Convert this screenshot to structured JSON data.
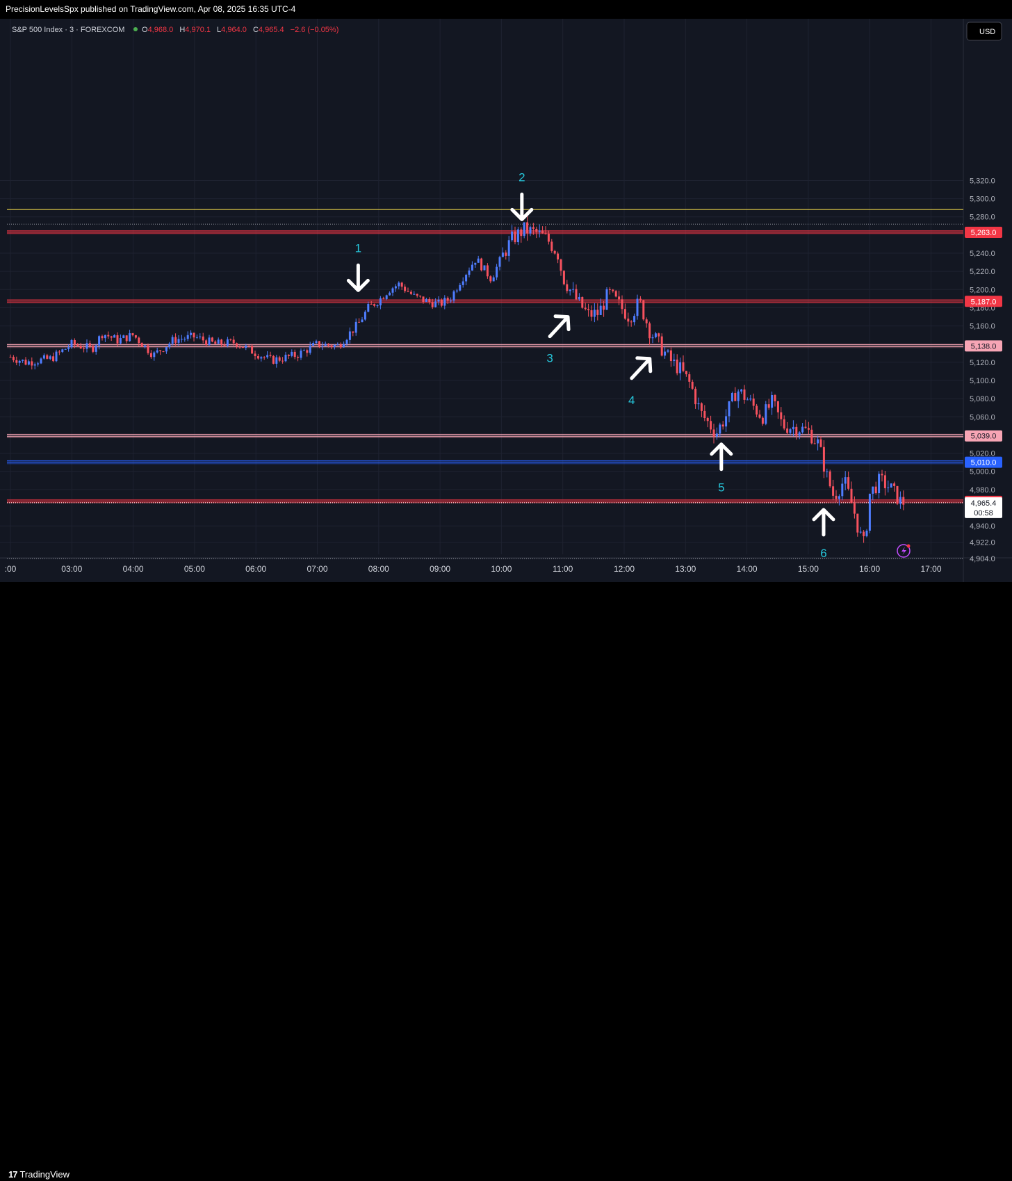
{
  "header": {
    "published": "PrecisionLevelsSpx published on TradingView.com, Apr 08, 2025 16:35 UTC-4"
  },
  "legend": {
    "symbol": "S&P 500 Index · 3 · FOREXCOM",
    "o_label": "O",
    "o_value": "4,968.0",
    "h_label": "H",
    "h_value": "4,970.1",
    "l_label": "L",
    "l_value": "4,964.0",
    "c_label": "C",
    "c_value": "4,965.4",
    "change": "−2.6 (−0.05%)"
  },
  "currency_button": "USD",
  "footer": {
    "brand": "TradingView",
    "logo_mark": "17"
  },
  "colors": {
    "background": "#131722",
    "panel": "#000000",
    "up": "#2962ff",
    "down": "#f23645",
    "pink_level": "#f7a5b5",
    "blue_level": "#2962ff",
    "yellow_level": "#e5cf48",
    "annotation": "#26c6da",
    "arrow": "#ffffff",
    "text": "#d1d4dc"
  },
  "chart_data": {
    "type": "candlestick",
    "x_axis_labels": [
      ":00",
      "03:00",
      "04:00",
      "05:00",
      "06:00",
      "07:00",
      "08:00",
      "09:00",
      "10:00",
      "11:00",
      "12:00",
      "13:00",
      "14:00",
      "15:00",
      "16:00",
      "17:00"
    ],
    "y_axis_labels": [
      "5,320.0",
      "5,300.0",
      "5,280.0",
      "5,240.0",
      "5,220.0",
      "5,200.0",
      "5,180.0",
      "5,160.0",
      "5,120.0",
      "5,100.0",
      "5,080.0",
      "5,060.0",
      "5,020.0",
      "5,000.0",
      "4,980.0",
      "4,940.0",
      "4,922.0",
      "4,904.0"
    ],
    "y_range": [
      4904,
      5320
    ],
    "levels": [
      {
        "value": 5263.0,
        "label": "5,263.0",
        "color": "red"
      },
      {
        "value": 5187.0,
        "label": "5,187.0",
        "color": "red"
      },
      {
        "value": 5138.0,
        "label": "5,138.0",
        "color": "pink"
      },
      {
        "value": 5039.0,
        "label": "5,039.0",
        "color": "pink"
      },
      {
        "value": 5010.0,
        "label": "5,010.0",
        "color": "blue"
      },
      {
        "value": 4967.0,
        "label": "4,967.0",
        "color": "red"
      }
    ],
    "yellow_line": 5288,
    "current_price": {
      "value": 4965.4,
      "label": "4,965.4",
      "countdown": "00:58"
    },
    "dotted_lines": [
      5272,
      4904
    ],
    "path_points": [
      [
        "02:00",
        5126
      ],
      [
        "02:15",
        5120
      ],
      [
        "02:40",
        5124
      ],
      [
        "03:00",
        5140
      ],
      [
        "03:20",
        5135
      ],
      [
        "03:30",
        5152
      ],
      [
        "03:45",
        5144
      ],
      [
        "04:00",
        5150
      ],
      [
        "04:20",
        5128
      ],
      [
        "04:40",
        5145
      ],
      [
        "05:00",
        5148
      ],
      [
        "05:20",
        5140
      ],
      [
        "05:40",
        5142
      ],
      [
        "06:00",
        5130
      ],
      [
        "06:15",
        5122
      ],
      [
        "06:40",
        5128
      ],
      [
        "07:00",
        5140
      ],
      [
        "07:20",
        5138
      ],
      [
        "07:40",
        5162
      ],
      [
        "07:50",
        5180
      ],
      [
        "08:00",
        5188
      ],
      [
        "08:10",
        5200
      ],
      [
        "08:20",
        5206
      ],
      [
        "08:35",
        5192
      ],
      [
        "08:50",
        5186
      ],
      [
        "09:00",
        5184
      ],
      [
        "09:10",
        5190
      ],
      [
        "09:20",
        5210
      ],
      [
        "09:35",
        5234
      ],
      [
        "09:50",
        5212
      ],
      [
        "10:00",
        5235
      ],
      [
        "10:10",
        5255
      ],
      [
        "10:22",
        5266
      ],
      [
        "10:35",
        5262
      ],
      [
        "10:45",
        5255
      ],
      [
        "10:55",
        5240
      ],
      [
        "11:00",
        5214
      ],
      [
        "11:08",
        5198
      ],
      [
        "11:15",
        5186
      ],
      [
        "11:25",
        5172
      ],
      [
        "11:35",
        5174
      ],
      [
        "11:45",
        5196
      ],
      [
        "11:55",
        5183
      ],
      [
        "12:05",
        5170
      ],
      [
        "12:15",
        5186
      ],
      [
        "12:25",
        5155
      ],
      [
        "12:35",
        5138
      ],
      [
        "12:45",
        5122
      ],
      [
        "12:55",
        5112
      ],
      [
        "13:05",
        5095
      ],
      [
        "13:15",
        5064
      ],
      [
        "13:30",
        5042
      ],
      [
        "13:40",
        5062
      ],
      [
        "13:50",
        5090
      ],
      [
        "14:00",
        5080
      ],
      [
        "14:15",
        5060
      ],
      [
        "14:25",
        5076
      ],
      [
        "14:35",
        5050
      ],
      [
        "14:50",
        5048
      ],
      [
        "15:00",
        5044
      ],
      [
        "15:10",
        5030
      ],
      [
        "15:18",
        4995
      ],
      [
        "15:25",
        4972
      ],
      [
        "15:35",
        4990
      ],
      [
        "15:45",
        4955
      ],
      [
        "15:50",
        4932
      ],
      [
        "15:55",
        4918
      ],
      [
        "16:00",
        4975
      ],
      [
        "16:10",
        4990
      ],
      [
        "16:20",
        4982
      ],
      [
        "16:30",
        4967
      ],
      [
        "16:35",
        4965.4
      ]
    ],
    "annotations": [
      {
        "label": "1",
        "time": "07:40",
        "price": 5190,
        "arrow": "down",
        "label_pos": "above"
      },
      {
        "label": "2",
        "time": "10:20",
        "price": 5268,
        "arrow": "down",
        "label_pos": "above"
      },
      {
        "label": "3",
        "time": "11:05",
        "price": 5176,
        "arrow": "up-right",
        "label_pos": "below"
      },
      {
        "label": "4",
        "time": "12:25",
        "price": 5130,
        "arrow": "up-right",
        "label_pos": "below"
      },
      {
        "label": "5",
        "time": "13:35",
        "price": 5039,
        "arrow": "up",
        "label_pos": "below"
      },
      {
        "label": "6",
        "time": "15:15",
        "price": 4967,
        "arrow": "up",
        "label_pos": "below"
      }
    ]
  }
}
